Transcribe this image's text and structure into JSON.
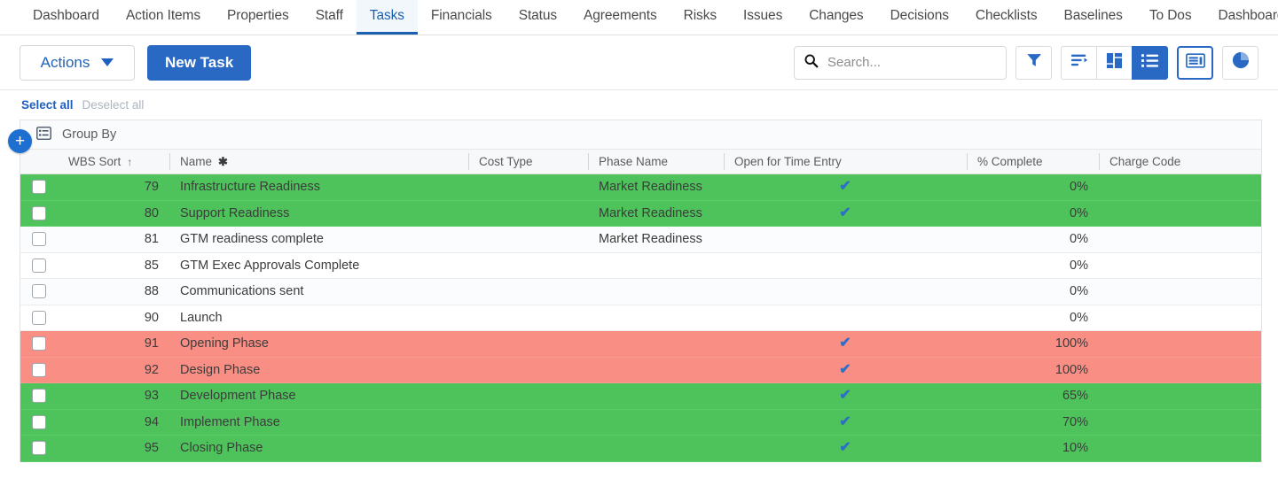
{
  "nav": {
    "items": [
      {
        "label": "Dashboard",
        "active": false
      },
      {
        "label": "Action Items",
        "active": false
      },
      {
        "label": "Properties",
        "active": false
      },
      {
        "label": "Staff",
        "active": false
      },
      {
        "label": "Tasks",
        "active": true
      },
      {
        "label": "Financials",
        "active": false
      },
      {
        "label": "Status",
        "active": false
      },
      {
        "label": "Agreements",
        "active": false
      },
      {
        "label": "Risks",
        "active": false
      },
      {
        "label": "Issues",
        "active": false
      },
      {
        "label": "Changes",
        "active": false
      },
      {
        "label": "Decisions",
        "active": false
      },
      {
        "label": "Checklists",
        "active": false
      },
      {
        "label": "Baselines",
        "active": false
      },
      {
        "label": "To Dos",
        "active": false
      },
      {
        "label": "Dashboard",
        "active": false
      }
    ]
  },
  "toolbar": {
    "actions_label": "Actions",
    "new_task_label": "New Task",
    "search_placeholder": "Search...",
    "search_value": "",
    "icons": [
      {
        "name": "filter-icon",
        "selected": false
      },
      {
        "name": "sort-icon",
        "selected": false
      },
      {
        "name": "board-view-icon",
        "selected": false
      },
      {
        "name": "list-view-icon",
        "selected": true
      },
      {
        "name": "card-view-icon",
        "selected": false,
        "outlined": true
      },
      {
        "name": "chart-view-icon",
        "selected": false
      }
    ]
  },
  "selection": {
    "select_all_label": "Select all",
    "deselect_all_label": "Deselect all"
  },
  "grid": {
    "group_by_label": "Group By",
    "add_button_label": "+",
    "columns": [
      {
        "key": "checkbox",
        "label": "",
        "class": "c-chk",
        "divider": false,
        "align": "center"
      },
      {
        "key": "wbs",
        "label": "WBS Sort",
        "class": "c-wbs",
        "divider": false,
        "sort": "↑",
        "align": "right"
      },
      {
        "key": "name",
        "label": "Name",
        "class": "c-name",
        "divider": true,
        "star": "✱",
        "align": "left"
      },
      {
        "key": "cost",
        "label": "Cost Type",
        "class": "c-cost",
        "divider": true,
        "align": "left"
      },
      {
        "key": "phase",
        "label": "Phase Name",
        "class": "c-phase",
        "divider": true,
        "align": "left"
      },
      {
        "key": "open",
        "label": "Open for Time Entry",
        "class": "c-open",
        "divider": true,
        "align": "center"
      },
      {
        "key": "pct",
        "label": "% Complete",
        "class": "c-pct",
        "divider": true,
        "align": "right"
      },
      {
        "key": "chg",
        "label": "Charge Code",
        "class": "c-chg",
        "divider": true,
        "align": "left"
      }
    ],
    "rows": [
      {
        "checked": false,
        "wbs": "79",
        "name": "Infrastructure Readiness",
        "cost": "",
        "phase": "Market Readiness",
        "open": true,
        "pct": "0%",
        "chg": "",
        "style": "green"
      },
      {
        "checked": false,
        "wbs": "80",
        "name": "Support Readiness",
        "cost": "",
        "phase": "Market Readiness",
        "open": true,
        "pct": "0%",
        "chg": "",
        "style": "green"
      },
      {
        "checked": false,
        "wbs": "81",
        "name": "GTM readiness complete",
        "cost": "",
        "phase": "Market Readiness",
        "open": false,
        "pct": "0%",
        "chg": "",
        "style": "alt"
      },
      {
        "checked": false,
        "wbs": "85",
        "name": "GTM Exec Approvals Complete",
        "cost": "",
        "phase": "",
        "open": false,
        "pct": "0%",
        "chg": "",
        "style": "white"
      },
      {
        "checked": false,
        "wbs": "88",
        "name": "Communications sent",
        "cost": "",
        "phase": "",
        "open": false,
        "pct": "0%",
        "chg": "",
        "style": "alt"
      },
      {
        "checked": false,
        "wbs": "90",
        "name": "Launch",
        "cost": "",
        "phase": "",
        "open": false,
        "pct": "0%",
        "chg": "",
        "style": "white"
      },
      {
        "checked": false,
        "wbs": "91",
        "name": "Opening Phase",
        "cost": "",
        "phase": "",
        "open": true,
        "pct": "100%",
        "chg": "",
        "style": "red"
      },
      {
        "checked": false,
        "wbs": "92",
        "name": "Design Phase",
        "cost": "",
        "phase": "",
        "open": true,
        "pct": "100%",
        "chg": "",
        "style": "red"
      },
      {
        "checked": false,
        "wbs": "93",
        "name": "Development Phase",
        "cost": "",
        "phase": "",
        "open": true,
        "pct": "65%",
        "chg": "",
        "style": "green"
      },
      {
        "checked": false,
        "wbs": "94",
        "name": "Implement Phase",
        "cost": "",
        "phase": "",
        "open": true,
        "pct": "70%",
        "chg": "",
        "style": "green"
      },
      {
        "checked": false,
        "wbs": "95",
        "name": "Closing Phase",
        "cost": "",
        "phase": "",
        "open": true,
        "pct": "10%",
        "chg": "",
        "style": "green"
      }
    ]
  },
  "colors": {
    "accent": "#2969c4",
    "row_green": "#4ec35b",
    "row_red": "#f98e84",
    "link": "#1f5fbf",
    "check": "#2d6fc4"
  }
}
